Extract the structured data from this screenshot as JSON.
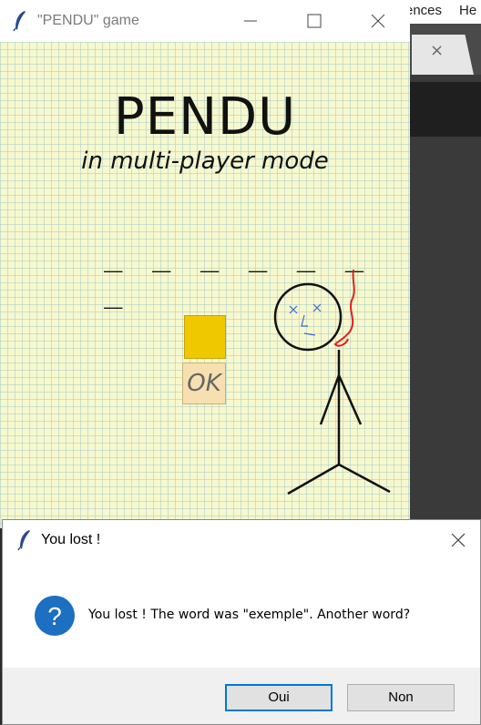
{
  "background_app": {
    "menu_text": "ences",
    "menu_text_2": "He",
    "tab_close": "×"
  },
  "game_window": {
    "title": "\"PENDU\" game",
    "icon": "feather-icon",
    "controls": [
      "minimize-icon",
      "maximize-icon",
      "close-icon"
    ]
  },
  "game": {
    "title": "PENDU",
    "subtitle": "in multi-player mode",
    "word_mask": "_ _ _ _ _ _ _",
    "letter_input_color": "#f0c800",
    "ok_label": "OK"
  },
  "dialog": {
    "title": "You lost !",
    "icon": "question-icon",
    "message": "You lost ! The word was \"exemple\". Another word?",
    "buttons": {
      "yes_label": "Oui",
      "no_label": "Non"
    },
    "accent": "#0078d7"
  }
}
